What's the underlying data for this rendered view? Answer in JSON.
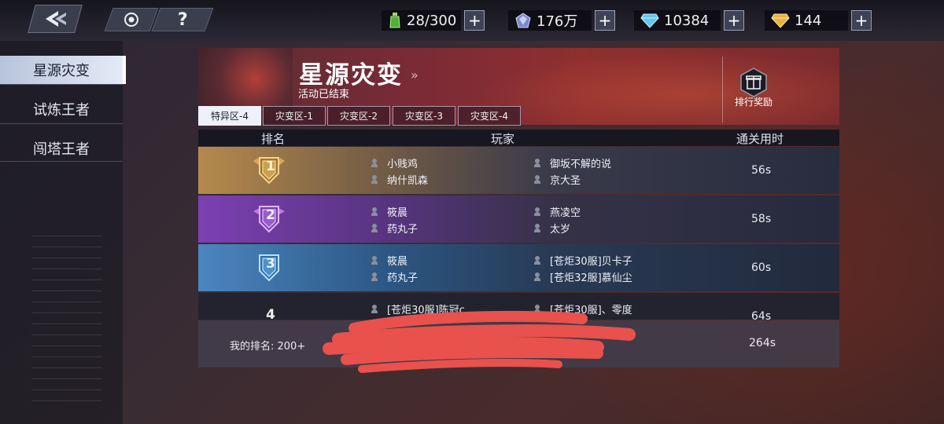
{
  "topbar": {
    "resources": [
      {
        "icon": "stamina-potion-icon",
        "value": "28/300"
      },
      {
        "icon": "silver-crystal-icon",
        "value": "176万"
      },
      {
        "icon": "blue-diamond-icon",
        "value": "10384"
      },
      {
        "icon": "gold-diamond-icon",
        "value": "144"
      }
    ],
    "help_label": "?"
  },
  "sidebar": {
    "items": [
      {
        "label": "星源灾变",
        "active": true
      },
      {
        "label": "试炼王者",
        "active": false
      },
      {
        "label": "闯塔王者",
        "active": false
      }
    ]
  },
  "banner": {
    "title": "星源灾变",
    "arrow": "»",
    "subtitle": "活动已结束",
    "reward_label": "排行奖励"
  },
  "tabs": [
    {
      "label": "特异区-4",
      "active": true
    },
    {
      "label": "灾变区-1",
      "active": false
    },
    {
      "label": "灾变区-2",
      "active": false
    },
    {
      "label": "灾变区-3",
      "active": false
    },
    {
      "label": "灾变区-4",
      "active": false
    }
  ],
  "table": {
    "headers": {
      "rank": "排名",
      "players": "玩家",
      "time": "通关用时"
    },
    "rows": [
      {
        "rank": "1",
        "players": [
          "小贱鸡",
          "御坂不解的说",
          "纳什凯森",
          "京大圣"
        ],
        "time": "56s"
      },
      {
        "rank": "2",
        "players": [
          "筱晨",
          "燕凌空",
          "药丸子",
          "太岁"
        ],
        "time": "58s"
      },
      {
        "rank": "3",
        "players": [
          "筱晨",
          "[苍炬30服]贝卡子",
          "药丸子",
          "[苍炬32服]慕仙尘"
        ],
        "time": "60s"
      },
      {
        "rank": "4",
        "players": [
          "[苍炬30服]陈冠c",
          "[苍炬30服]、零度",
          "",
          ""
        ],
        "time": "64s"
      }
    ]
  },
  "my_rank": {
    "label": "我的排名:  200+",
    "time": "264s"
  },
  "colors": {
    "redaction": "#e8514c",
    "active_tab": "#eef1f8"
  }
}
